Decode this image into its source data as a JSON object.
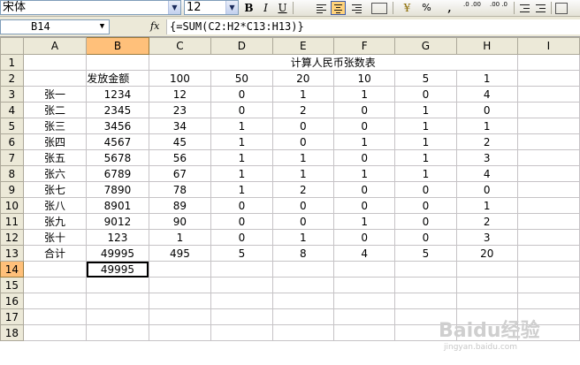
{
  "toolbar": {
    "font_name": "宋体",
    "font_size": "12",
    "bold": "B",
    "italic": "I",
    "underline": "U",
    "percent": "%",
    "comma": ",",
    "inc_decimal": ".0 .00",
    "dec_decimal": ".00 .0"
  },
  "formula_bar": {
    "cell_ref": "B14",
    "fx": "fx",
    "formula": "{=SUM(C2:H2*C13:H13)}"
  },
  "columns": [
    "A",
    "B",
    "C",
    "D",
    "E",
    "F",
    "G",
    "H",
    "I"
  ],
  "active_col": "B",
  "active_row": "14",
  "sheet": {
    "title": "计算人民币张数表",
    "header_label": "发放金额",
    "denominations": [
      "100",
      "50",
      "20",
      "10",
      "5",
      "1"
    ],
    "rows": [
      {
        "name": "张一",
        "amount": "1234",
        "counts": [
          "12",
          "0",
          "1",
          "1",
          "0",
          "4"
        ]
      },
      {
        "name": "张二",
        "amount": "2345",
        "counts": [
          "23",
          "0",
          "2",
          "0",
          "1",
          "0"
        ]
      },
      {
        "name": "张三",
        "amount": "3456",
        "counts": [
          "34",
          "1",
          "0",
          "0",
          "1",
          "1"
        ]
      },
      {
        "name": "张四",
        "amount": "4567",
        "counts": [
          "45",
          "1",
          "0",
          "1",
          "1",
          "2"
        ]
      },
      {
        "name": "张五",
        "amount": "5678",
        "counts": [
          "56",
          "1",
          "1",
          "0",
          "1",
          "3"
        ]
      },
      {
        "name": "张六",
        "amount": "6789",
        "counts": [
          "67",
          "1",
          "1",
          "1",
          "1",
          "4"
        ]
      },
      {
        "name": "张七",
        "amount": "7890",
        "counts": [
          "78",
          "1",
          "2",
          "0",
          "0",
          "0"
        ]
      },
      {
        "name": "张八",
        "amount": "8901",
        "counts": [
          "89",
          "0",
          "0",
          "0",
          "0",
          "1"
        ]
      },
      {
        "name": "张九",
        "amount": "9012",
        "counts": [
          "90",
          "0",
          "0",
          "1",
          "0",
          "2"
        ]
      },
      {
        "name": "张十",
        "amount": "123",
        "counts": [
          "1",
          "0",
          "1",
          "0",
          "0",
          "3"
        ]
      }
    ],
    "total": {
      "name": "合计",
      "amount": "49995",
      "counts": [
        "495",
        "5",
        "8",
        "4",
        "5",
        "20"
      ]
    },
    "result": "49995"
  },
  "row_numbers": [
    "1",
    "2",
    "3",
    "4",
    "5",
    "6",
    "7",
    "8",
    "9",
    "10",
    "11",
    "12",
    "13",
    "14",
    "15",
    "16",
    "17",
    "18"
  ],
  "watermark": "Baidu经验",
  "watermark_sub": "jingyan.baidu.com"
}
